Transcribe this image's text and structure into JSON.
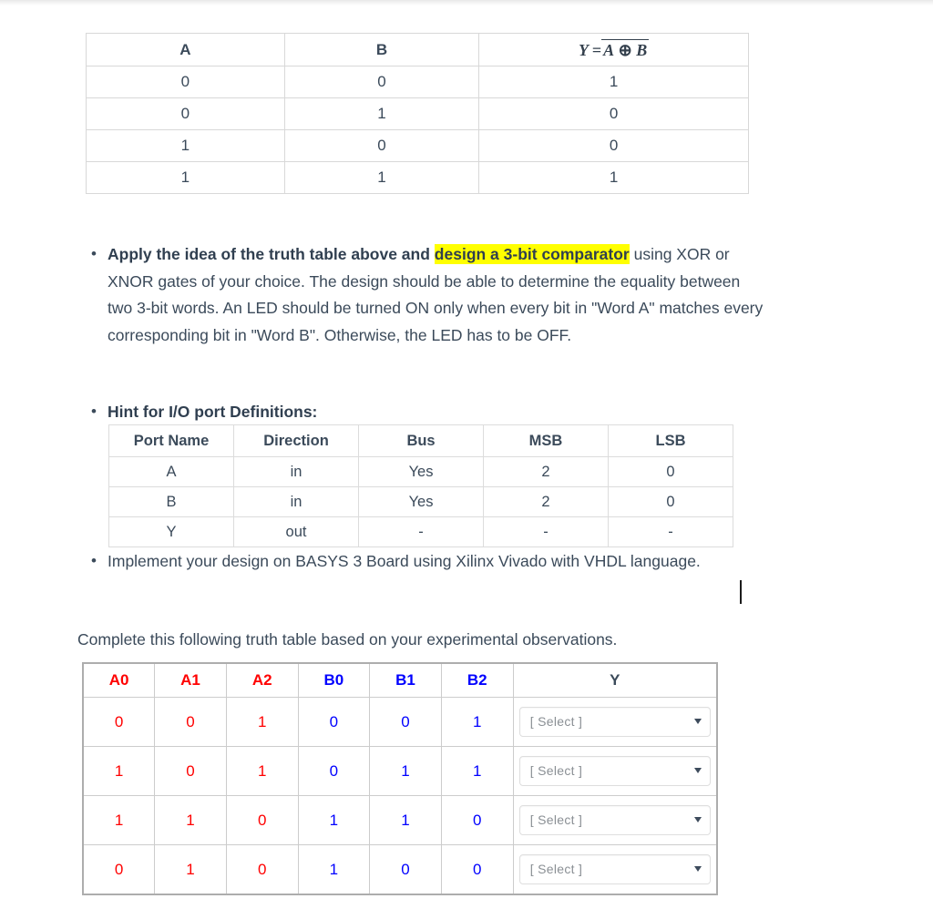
{
  "xnor_table": {
    "name": "xnor-truth-table",
    "headers": [
      "A",
      "B",
      "Y = A XNOR B"
    ],
    "formula": {
      "lhs": "Y =",
      "inner_a": "A",
      "op": "⊕",
      "inner_b": "B"
    },
    "rows": [
      [
        "0",
        "0",
        "1"
      ],
      [
        "0",
        "1",
        "0"
      ],
      [
        "1",
        "0",
        "0"
      ],
      [
        "1",
        "1",
        "1"
      ]
    ]
  },
  "bullets": {
    "item1": {
      "bold_lead": "Apply the idea of the truth table above and ",
      "highlight": "design a 3-bit comparator",
      "rest": " using XOR or XNOR gates of your choice. The design should be able to determine the equality between two 3-bit words. An LED should be turned ON only when every bit in \"Word A\" matches every corresponding bit in \"Word B\". Otherwise, the LED has to be OFF."
    },
    "item2": {
      "label": "Hint for I/O port Definitions:"
    },
    "item3": {
      "text": "Implement your design on BASYS 3 Board using Xilinx Vivado with VHDL language."
    }
  },
  "io_table": {
    "name": "io-port-definitions-table",
    "headers": [
      "Port Name",
      "Direction",
      "Bus",
      "MSB",
      "LSB"
    ],
    "rows": [
      [
        "A",
        "in",
        "Yes",
        "2",
        "0"
      ],
      [
        "B",
        "in",
        "Yes",
        "2",
        "0"
      ],
      [
        "Y",
        "out",
        "-",
        "-",
        "-"
      ]
    ]
  },
  "instruction": {
    "complete_line": "Complete this following truth table based on your experimental observations."
  },
  "answer_table": {
    "name": "experimental-truth-table",
    "headers": [
      "A0",
      "A1",
      "A2",
      "B0",
      "B1",
      "B2",
      "Y"
    ],
    "header_colors": [
      "#ff0000",
      "#ff0000",
      "#ff0000",
      "#0000ff",
      "#0000ff",
      "#0000ff",
      "#3b4a5a"
    ],
    "rows": [
      {
        "a": [
          "0",
          "0",
          "1"
        ],
        "b": [
          "0",
          "0",
          "1"
        ],
        "y_value": "[ Select ]"
      },
      {
        "a": [
          "1",
          "0",
          "1"
        ],
        "b": [
          "0",
          "1",
          "1"
        ],
        "y_value": "[ Select ]"
      },
      {
        "a": [
          "1",
          "1",
          "0"
        ],
        "b": [
          "1",
          "1",
          "0"
        ],
        "y_value": "[ Select ]"
      },
      {
        "a": [
          "0",
          "1",
          "0"
        ],
        "b": [
          "1",
          "0",
          "0"
        ],
        "y_value": "[ Select ]"
      }
    ],
    "select_placeholder": "[ Select ]"
  },
  "colors": {
    "text": "#3b4a5a",
    "red": "#ff0000",
    "blue": "#0000ff",
    "highlight": "#ffff00",
    "border": "#cccccc"
  }
}
